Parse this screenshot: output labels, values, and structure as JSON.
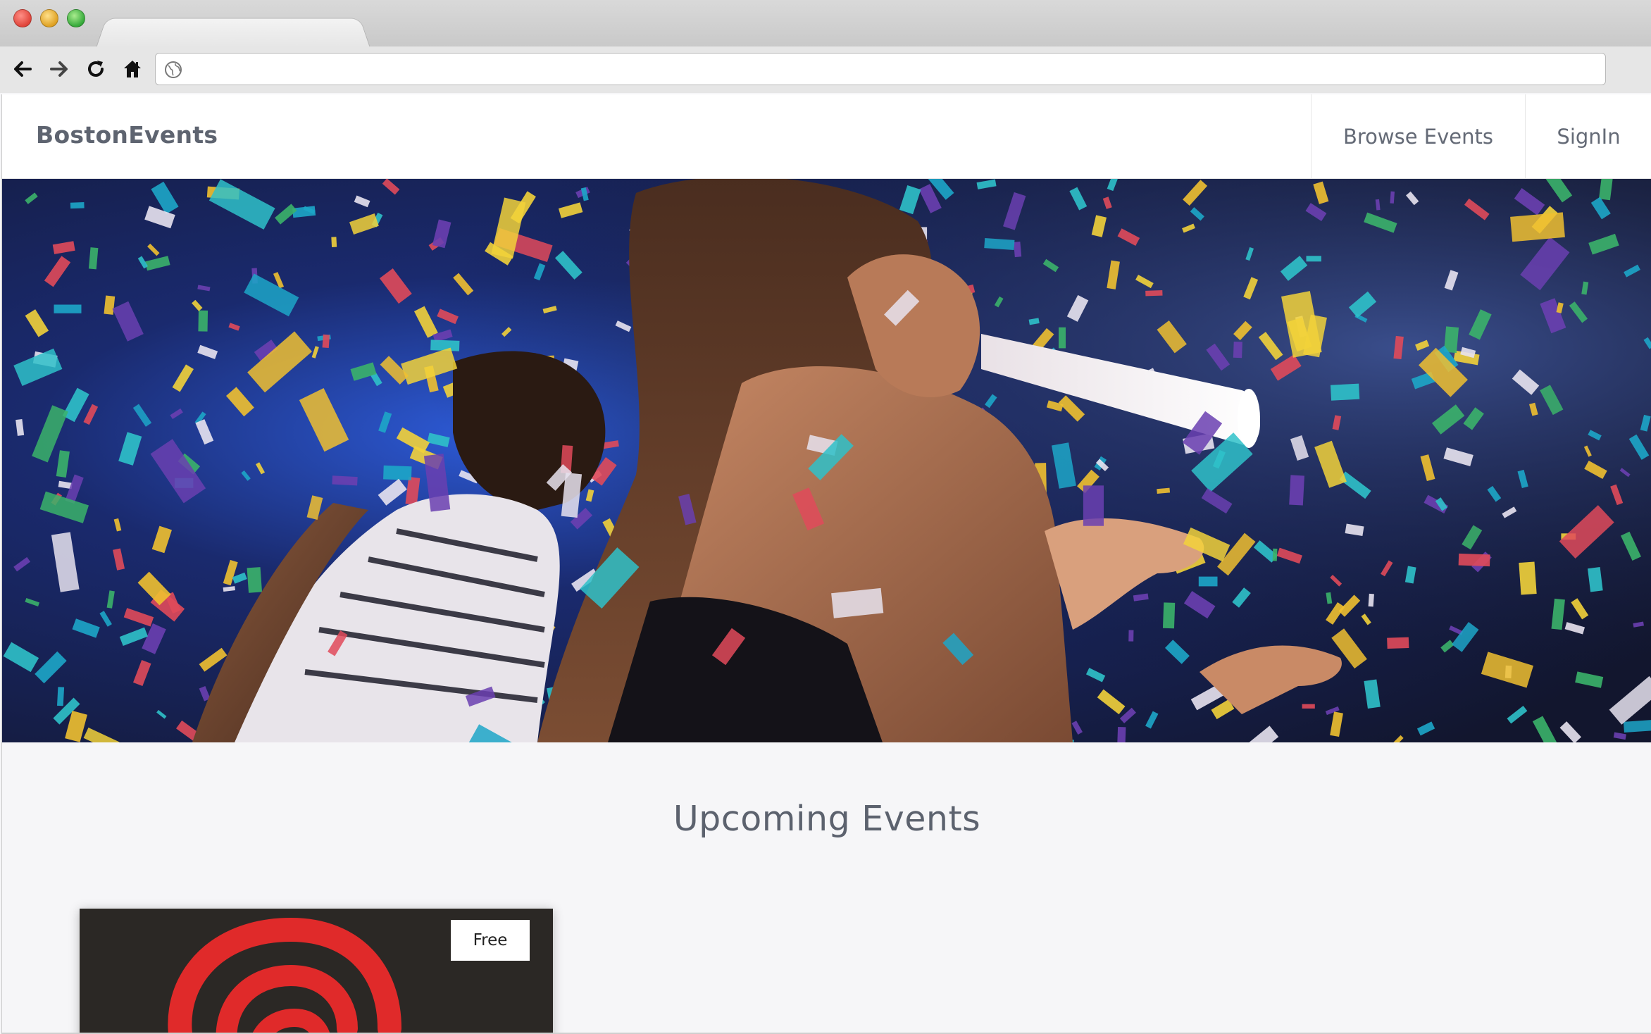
{
  "site": {
    "brand": "BostonEvents",
    "nav": {
      "browse_events": "Browse Events",
      "signin": "SignIn"
    }
  },
  "hero": {
    "image": "party-crowd-confetti-photo"
  },
  "main": {
    "section_title": "Upcoming Events",
    "events": [
      {
        "price_label": "Free",
        "image": "red-swirl-logo"
      }
    ]
  },
  "browser": {
    "address_value": "",
    "icons": {
      "back": "arrow-left-icon",
      "forward": "arrow-right-icon",
      "reload": "reload-icon",
      "home": "home-icon",
      "site": "globe-icon"
    }
  },
  "colors": {
    "brand_text": "#5e6470",
    "event_card_bg": "#2b2825",
    "logo_red": "#e02a2a"
  }
}
